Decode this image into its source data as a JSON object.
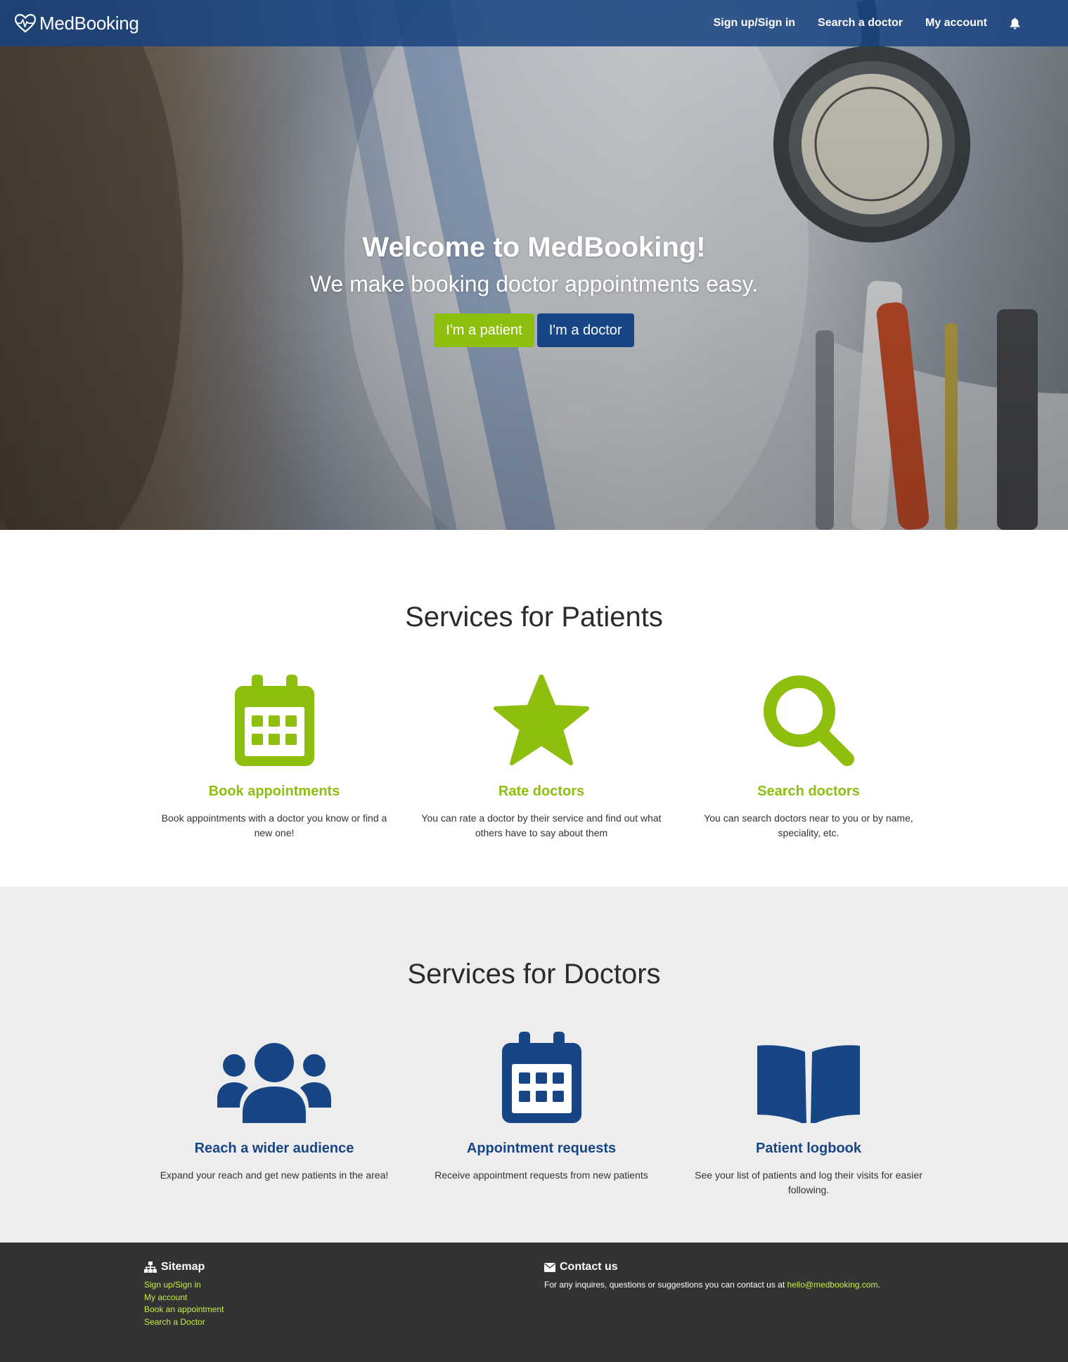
{
  "nav": {
    "brand": "MedBooking",
    "links": [
      "Sign up/Sign in",
      "Search a doctor",
      "My account"
    ],
    "icons": {
      "logo": "heart-pulse-icon",
      "notifications": "bell-icon"
    }
  },
  "hero": {
    "title": "Welcome to MedBooking!",
    "subtitle": "We make booking doctor appointments easy.",
    "patient_button": "I'm a patient",
    "doctor_button": "I'm a doctor"
  },
  "patients": {
    "title": "Services for Patients",
    "cards": [
      {
        "icon": "calendar-icon",
        "title": "Book appointments",
        "desc": "Book appointments with a doctor you know or find a new one!"
      },
      {
        "icon": "star-icon",
        "title": "Rate doctors",
        "desc": "You can rate a doctor by their service and find out what others have to say about them"
      },
      {
        "icon": "search-icon",
        "title": "Search doctors",
        "desc": "You can search doctors near to you or by name, speciality, etc."
      }
    ]
  },
  "doctors": {
    "title": "Services for Doctors",
    "cards": [
      {
        "icon": "users-icon",
        "title": "Reach a wider audience",
        "desc": "Expand your reach and get new patients in the area!"
      },
      {
        "icon": "calendar-icon",
        "title": "Appointment requests",
        "desc": "Receive appointment requests from new patients"
      },
      {
        "icon": "book-open-icon",
        "title": "Patient logbook",
        "desc": "See your list of patients and log their visits for easier following."
      }
    ]
  },
  "footer": {
    "sitemap_title": "Sitemap",
    "sitemap_links": [
      "Sign up/Sign in",
      "My account",
      "Book an appointment",
      "Search a Doctor"
    ],
    "contact_title": "Contact us",
    "contact_text": "For any inquires, questions or suggestions you can contact us at ",
    "contact_email": "hello@medbooking.com",
    "contact_end": "."
  },
  "colors": {
    "navbar": "#184580",
    "green_accent": "#8ebf0f",
    "blue_accent": "#184585",
    "footer_bg": "#333333",
    "footer_link": "#c5ee42",
    "doctors_bg": "#ededed"
  }
}
